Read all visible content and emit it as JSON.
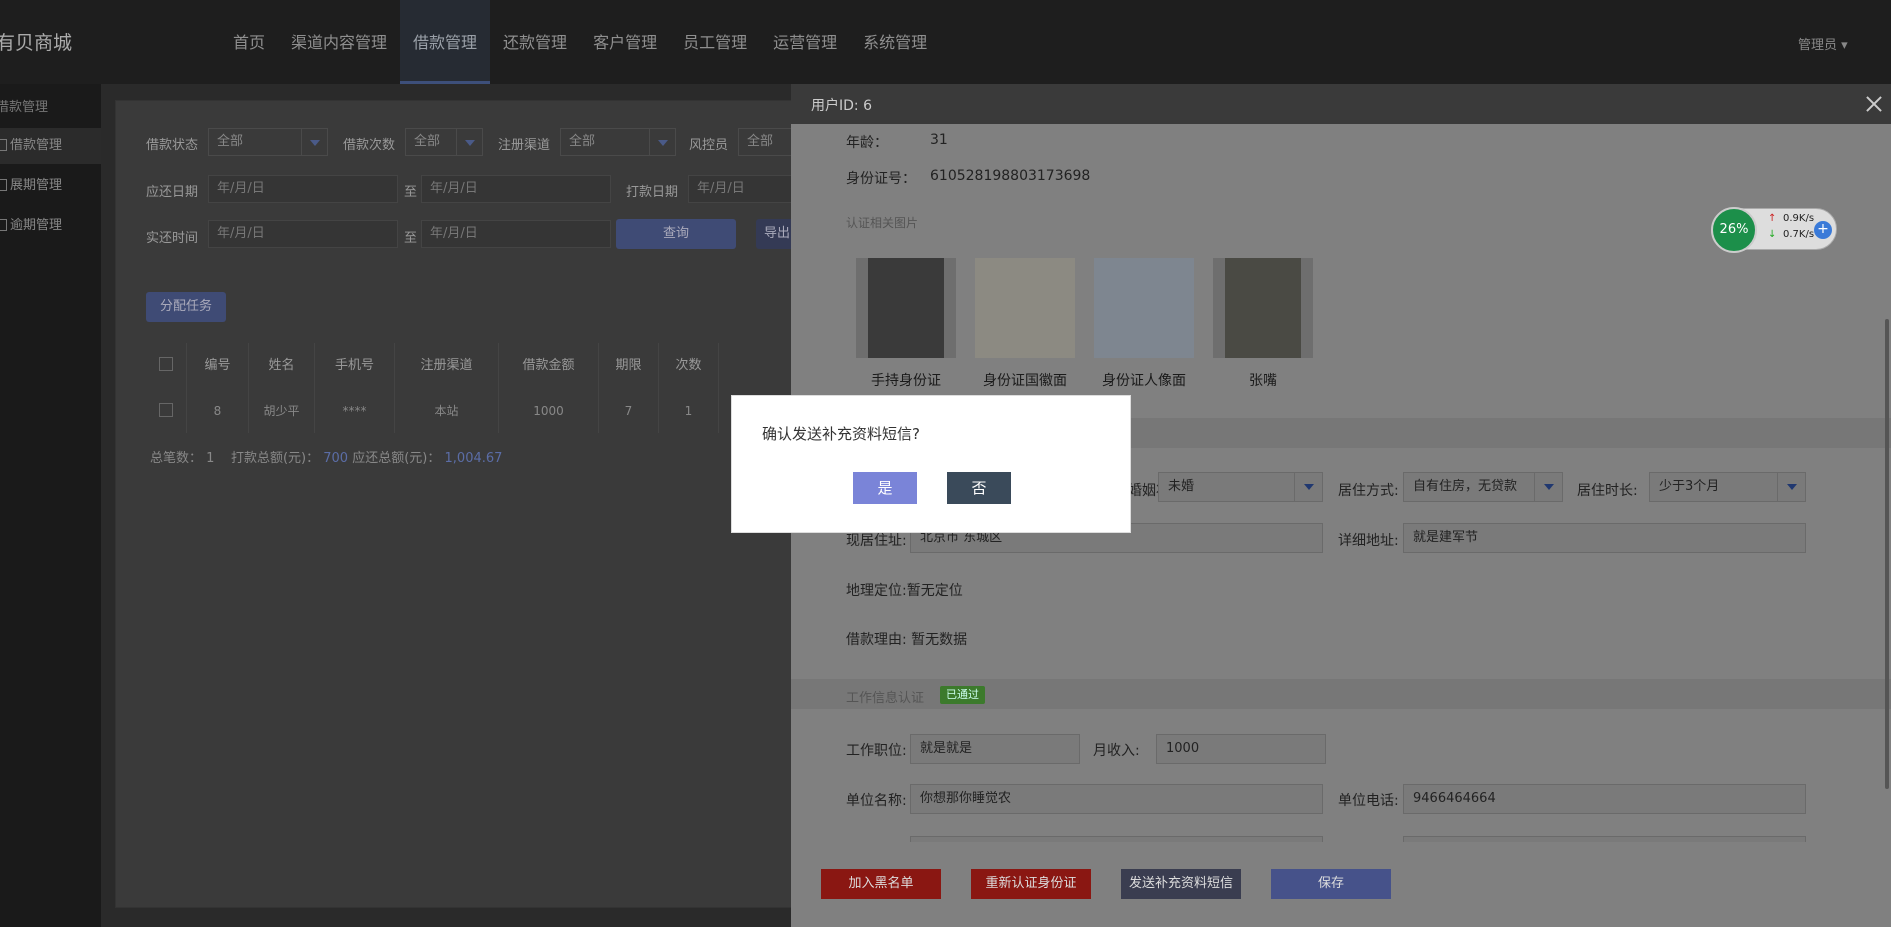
{
  "header": {
    "brand": "有贝商城",
    "nav": [
      "首页",
      "渠道内容管理",
      "借款管理",
      "还款管理",
      "客户管理",
      "员工管理",
      "运营管理",
      "系统管理"
    ],
    "active_nav_index": 2,
    "admin": "管理员 ▾"
  },
  "sidebar": {
    "heading": "借款管理",
    "items": [
      "借款管理",
      "展期管理",
      "逾期管理"
    ],
    "active_index": 0
  },
  "filters": {
    "loan_status_label": "借款状态",
    "loan_status_value": "全部",
    "loan_count_label": "借款次数",
    "loan_count_value": "全部",
    "channel_label": "注册渠道",
    "channel_value": "全部",
    "risk_label": "风控员",
    "risk_value": "全部",
    "due_date_label": "应还日期",
    "pay_date_label": "打款日期",
    "actual_time_label": "实还时间",
    "date_placeholder": "年/月/日",
    "to": "至",
    "query_button": "查询",
    "export_button": "导出",
    "assign_button": "分配任务"
  },
  "table": {
    "headers": [
      "编号",
      "姓名",
      "手机号",
      "注册渠道",
      "借款金额",
      "期限",
      "次数"
    ],
    "rows": [
      [
        "8",
        "胡少平",
        "****",
        "本站",
        "1000",
        "7",
        "1"
      ]
    ]
  },
  "summary": {
    "count_label": "总笔数：",
    "count": "1",
    "paid_label": "打款总额(元)：",
    "paid": "700",
    "due_label": "应还总额(元)：",
    "due": "1,004.67"
  },
  "drawer": {
    "title": "用户ID: 6",
    "age_label": "年龄：",
    "age": "31",
    "id_label": "身份证号：",
    "id_number": "610528198803173698",
    "photos_label": "认证相关图片",
    "photos": [
      "手持身份证",
      "身份证国徽面",
      "身份证人像面",
      "张嘴"
    ],
    "marital_label": "婚姻状况:",
    "marital_value": "未婚",
    "living_label": "居住方式:",
    "living_value": "自有住房，无贷款",
    "duration_label": "居住时长:",
    "duration_value": "少于3个月",
    "address_label": "现居住址:",
    "address_value": "北京市 东城区",
    "detail_label": "详细地址:",
    "detail_value": "就是建军节",
    "location_text": "地理定位:暂无定位",
    "reason_text": "借款理由: 暂无数据",
    "work_section": "工作信息认证",
    "work_badge": "已通过",
    "job_label": "工作职位:",
    "job_value": "就是就是",
    "income_label": "月收入:",
    "income_value": "1000",
    "company_label": "单位名称:",
    "company_value": "你想那你睡觉农",
    "phone_label": "单位电话:",
    "phone_value": "9466464664",
    "actions": [
      "加入黑名单",
      "重新认证身份证",
      "发送补充资料短信",
      "保存"
    ]
  },
  "widget": {
    "percent": "26%",
    "up": "0.9K/s",
    "down": "0.7K/s",
    "plus": "+"
  },
  "dialog": {
    "message": "确认发送补充资料短信?",
    "yes": "是",
    "no": "否"
  },
  "colors": {
    "accent": "#7a84d8",
    "danger": "#c0201a",
    "badge": "#3c7a2c"
  }
}
